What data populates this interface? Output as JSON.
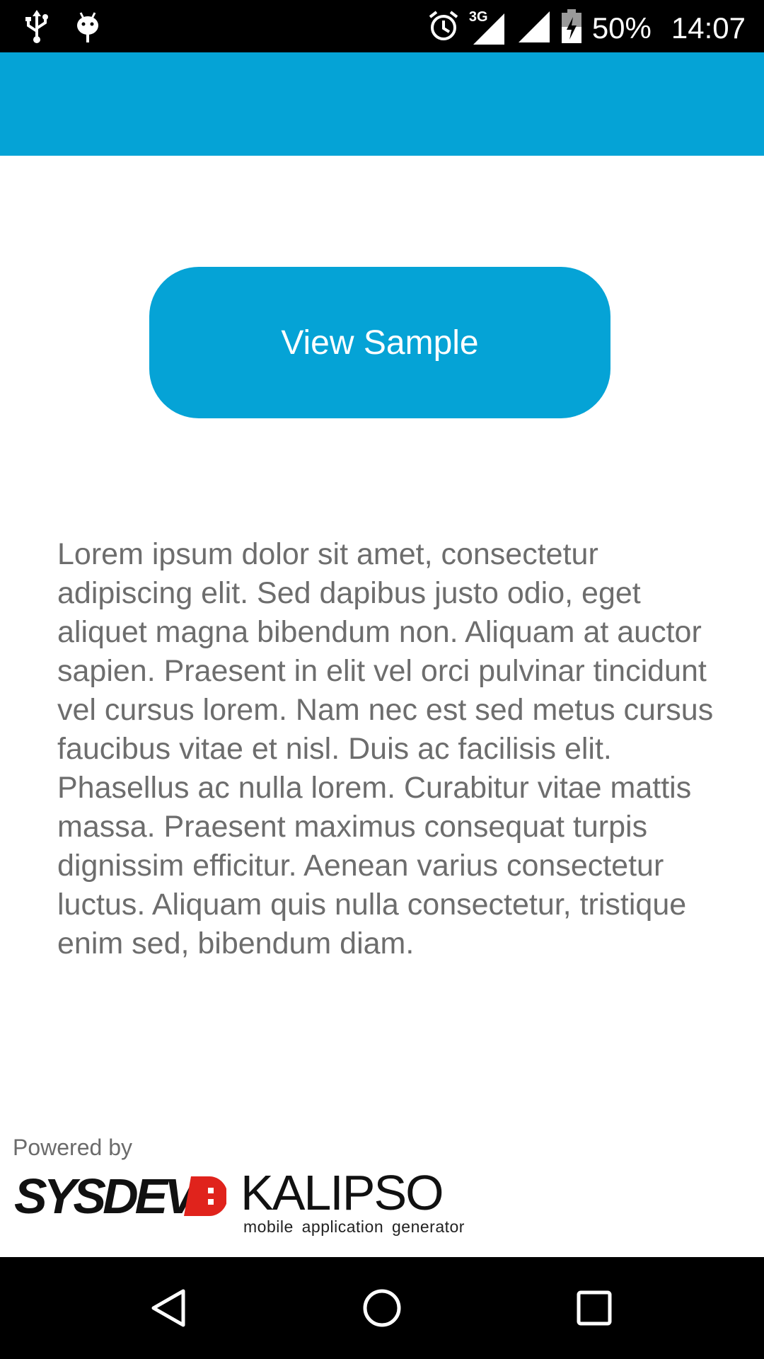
{
  "status_bar": {
    "battery": "50%",
    "time": "14:07",
    "network": "3G",
    "icons": [
      "usb-icon",
      "android-debug-icon",
      "alarm-icon",
      "signal-3g-icon",
      "signal-icon",
      "battery-charging-icon"
    ]
  },
  "colors": {
    "accent": "#05a3d6",
    "text": "#6d6d6d",
    "logo_red": "#e0231c"
  },
  "main": {
    "button_label": "View Sample",
    "body_text": "Lorem ipsum dolor sit amet, consectetur adipiscing elit. Sed dapibus justo odio, eget aliquet magna bibendum non. Aliquam at auctor sapien. Praesent in elit vel orci pulvinar tincidunt vel cursus lorem. Nam nec est sed metus cursus faucibus vitae et nisl. Duis ac facilisis elit. Phasellus ac nulla lorem. Curabitur vitae mattis massa. Praesent maximus consequat turpis dignissim efficitur. Aenean varius consectetur luctus. Aliquam quis nulla consectetur, tristique enim sed, bibendum diam."
  },
  "footer": {
    "powered_label": "Powered by",
    "sysdev_logo": "SYSDEV",
    "kalipso_logo": "KALIPSO",
    "kalipso_tagline": "mobile application generator"
  },
  "nav_bar": {
    "icons": [
      "back-icon",
      "home-icon",
      "recents-icon"
    ]
  }
}
